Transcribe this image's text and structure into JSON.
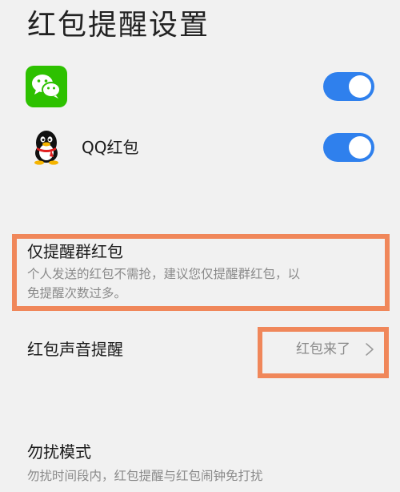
{
  "header": {
    "title": "红包提醒设置"
  },
  "apps": [
    {
      "name": "",
      "icon": "wechat-icon",
      "enabled": true
    },
    {
      "name": "QQ红包",
      "icon": "qq-penguin-icon",
      "enabled": true
    }
  ],
  "group_only": {
    "title": "仅提醒群红包",
    "description": "个人发送的红包不需抢，建议您仅提醒群红包，以免提醒次数过多。"
  },
  "sound": {
    "title": "红包声音提醒",
    "value": "红包来了"
  },
  "dnd": {
    "title": "勿扰模式",
    "description": "勿扰时间段内，红包提醒与红包闹钟免打扰"
  },
  "colors": {
    "background": "#f1f1f1",
    "toggle_on": "#2f80ed",
    "wechat_green": "#2dc100",
    "highlight_border": "#f0875a",
    "secondary_text": "#8a8a8a"
  }
}
